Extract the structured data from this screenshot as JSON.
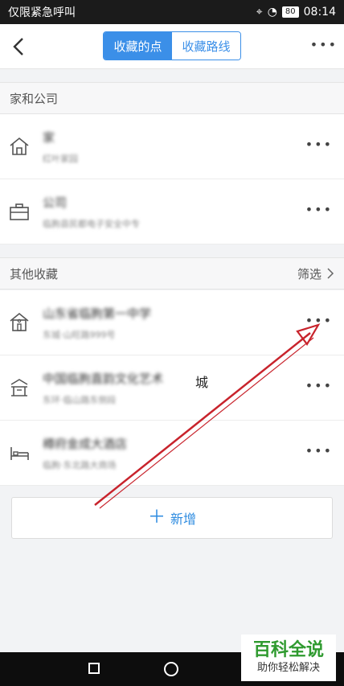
{
  "status_bar": {
    "carrier_text": "仅限紧急呼叫",
    "battery": "80",
    "time": "08:14"
  },
  "header": {
    "tabs": [
      {
        "label": "收藏的点",
        "active": true
      },
      {
        "label": "收藏路线",
        "active": false
      }
    ],
    "more_label": "•••"
  },
  "home_company": {
    "title": "家和公司",
    "items": [
      {
        "icon": "home-icon",
        "title": "家",
        "subtitle": "红叶家园",
        "more": "•••"
      },
      {
        "icon": "briefcase-icon",
        "title": "公司",
        "subtitle": "临朐县民都电子安全中专",
        "more": "•••"
      }
    ]
  },
  "other": {
    "title": "其他收藏",
    "filter_label": "筛选",
    "items": [
      {
        "icon": "school-icon",
        "title": "山东省临朐第一中学",
        "subtitle": "东城·山旺路999号",
        "more": "•••"
      },
      {
        "icon": "building-icon",
        "title": "中国临朐直韵文化艺术",
        "title_suffix": "城",
        "subtitle": "东环·临山路东侧段",
        "more": "•••"
      },
      {
        "icon": "bed-icon",
        "title": "樽府金成大酒店",
        "subtitle": "临朐·东北路大商场",
        "more": "•••"
      }
    ]
  },
  "add_button": {
    "label": "新增",
    "plus": "＋"
  },
  "watermark": {
    "title": "百科全说",
    "subtitle": "助你轻松解决"
  },
  "colors": {
    "accent": "#3b8fe8",
    "arrow": "#c8232c"
  }
}
